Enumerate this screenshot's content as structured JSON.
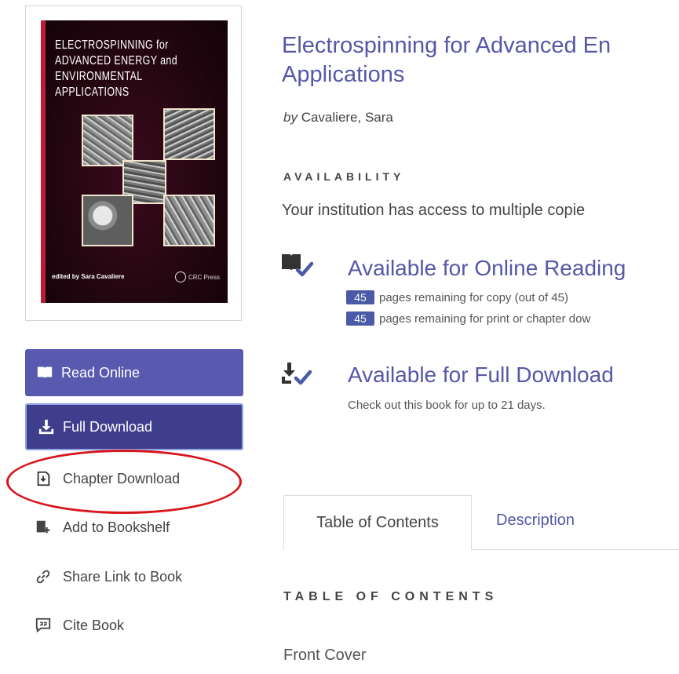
{
  "cover": {
    "title_line1": "ELECTROSPINNING",
    "title_line1_suffix": "for",
    "title_line2": "ADVANCED ENERGY",
    "title_line2_suffix": "and",
    "title_line3": "ENVIRONMENTAL APPLICATIONS",
    "editor": "edited by Sara Cavaliere",
    "publisher": "CRC Press"
  },
  "sidebar": {
    "read_online": "Read Online",
    "full_download": "Full Download",
    "chapter_download": "Chapter Download",
    "add_to_bookshelf": "Add to Bookshelf",
    "share_link": "Share Link to Book",
    "cite_book": "Cite Book"
  },
  "book": {
    "title_line1": "Electrospinning for Advanced En",
    "title_line2": "Applications",
    "by_prefix": "by",
    "author": "Cavaliere, Sara"
  },
  "availability": {
    "heading": "AVAILABILITY",
    "access_text": "Your institution has access to multiple copie",
    "online": {
      "title": "Available for Online Reading",
      "copy_count": "45",
      "copy_text": "pages remaining for copy (out of 45)",
      "print_count": "45",
      "print_text": "pages remaining for print or chapter dow"
    },
    "download": {
      "title": "Available for Full Download",
      "subtitle": "Check out this book for up to 21 days."
    }
  },
  "tabs": {
    "toc": "Table of Contents",
    "description": "Description"
  },
  "toc": {
    "heading": "TABLE OF CONTENTS",
    "items": [
      "Front Cover"
    ]
  },
  "colors": {
    "accent": "#5657a7",
    "button_primary": "#5a59b0",
    "button_dark": "#3f3e8c",
    "highlight": "#d7161d",
    "badge": "#4a5aa6"
  }
}
